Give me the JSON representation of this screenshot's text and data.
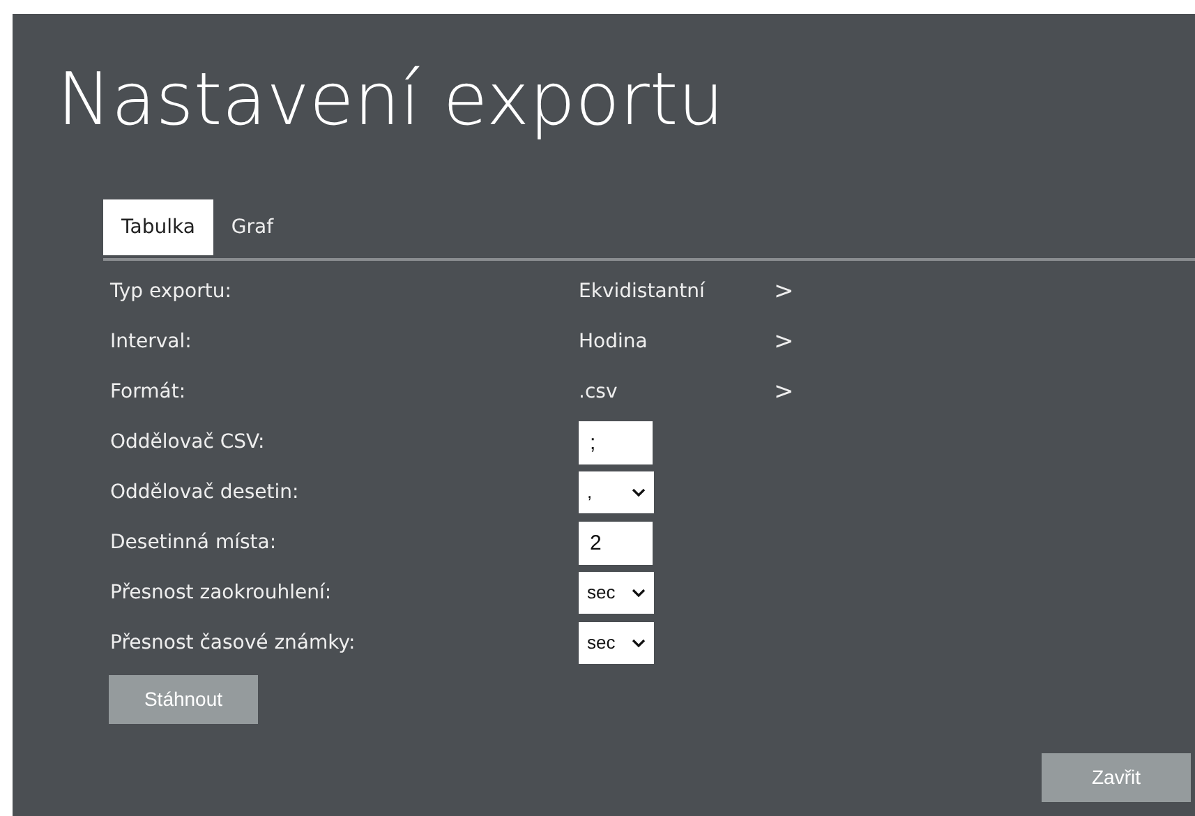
{
  "title": "Nastavení exportu",
  "tabs": [
    {
      "label": "Tabulka",
      "selected": true
    },
    {
      "label": "Graf",
      "selected": false
    }
  ],
  "rows": [
    {
      "kind": "choice",
      "label": "Typ exportu:",
      "value": "Ekvidistantní",
      "chevron": ">"
    },
    {
      "kind": "choice",
      "label": "Interval:",
      "value": "Hodina",
      "chevron": ">"
    },
    {
      "kind": "choice",
      "label": "Formát:",
      "value": ".csv",
      "chevron": ">"
    },
    {
      "kind": "input",
      "label": "Oddělovač CSV:",
      "value": ";"
    },
    {
      "kind": "select",
      "label": "Oddělovač desetin:",
      "value": ","
    },
    {
      "kind": "input",
      "label": "Desetinná místa:",
      "value": "2"
    },
    {
      "kind": "select",
      "label": "Přesnost zaokrouhlení:",
      "value": "sec"
    },
    {
      "kind": "select",
      "label": "Přesnost časové známky:",
      "value": "sec"
    }
  ],
  "download_button": "Stáhnout",
  "close_button": "Zavřit"
}
